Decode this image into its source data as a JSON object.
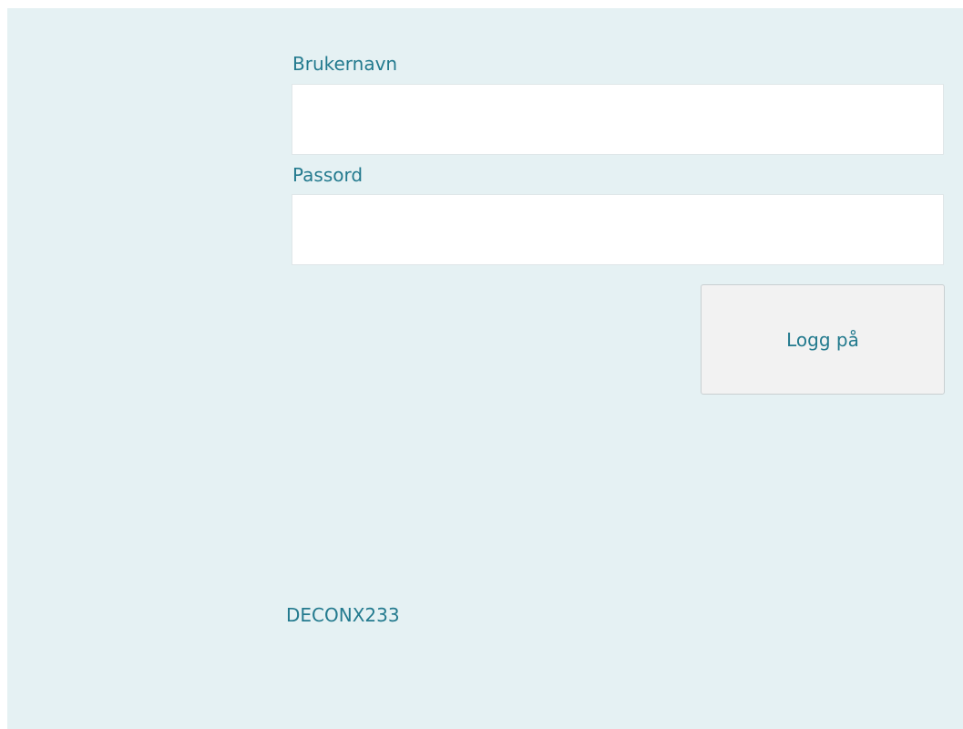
{
  "login_form": {
    "username_label": "Brukernavn",
    "username_value": "",
    "password_label": "Passord",
    "password_value": "",
    "submit_label": "Logg på"
  },
  "footer": {
    "station_code": "DECONX233"
  },
  "colors": {
    "background": "#e5f1f3",
    "text_accent": "#237a8e",
    "field_background": "#ffffff",
    "button_background": "#f2f2f2"
  }
}
